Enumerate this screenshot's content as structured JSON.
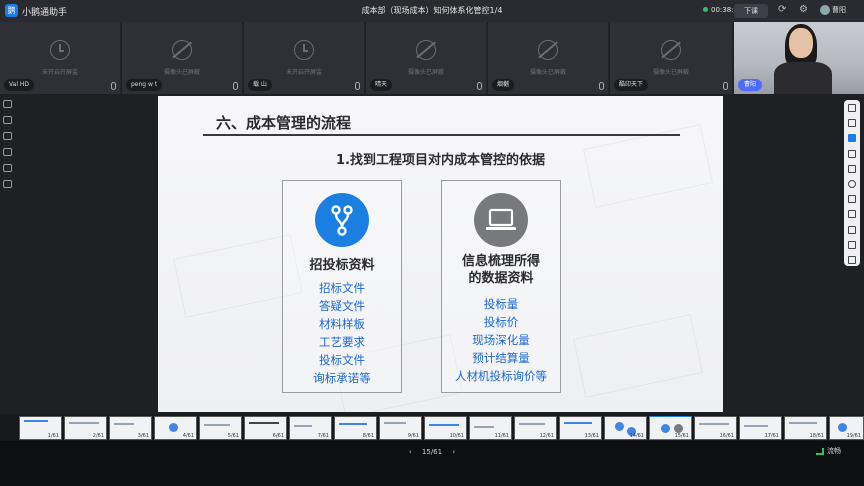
{
  "app": {
    "logo": "鹅",
    "title": "小鹅通助手"
  },
  "meeting": {
    "title": "成本部（现场成本）知何体系化管控1/4",
    "timer": "00:38:33",
    "leave_label": "下课"
  },
  "user": {
    "name": "曹阳"
  },
  "tiles": [
    {
      "name": "Val HD",
      "status": "未开启开屏监",
      "icon": "clock-icon"
    },
    {
      "name": "peng w t",
      "status": "摄像头已屏蔽",
      "icon": "camera-off-icon"
    },
    {
      "name": "载 山",
      "status": "未开启开屏监",
      "icon": "clock-icon"
    },
    {
      "name": "晴天",
      "status": "摄像头已屏蔽",
      "icon": "camera-off-icon"
    },
    {
      "name": "烟樾",
      "status": "摄像头已屏蔽",
      "icon": "camera-off-icon"
    },
    {
      "name": "酷印天下",
      "status": "摄像头已屏蔽",
      "icon": "camera-off-icon"
    }
  ],
  "host": {
    "name": "曹阳"
  },
  "slide": {
    "heading": "六、成本管理的流程",
    "subheading": "1.找到工程项目对内成本管控的依据",
    "left_card": {
      "title": "招投标资料",
      "items": [
        "招标文件",
        "答疑文件",
        "材料样板",
        "工艺要求",
        "投标文件",
        "询标承诺等"
      ]
    },
    "right_card": {
      "title_line1": "信息梳理所得",
      "title_line2": "的数据资料",
      "items": [
        "投标量",
        "投标价",
        "现场深化量",
        "预计结算量",
        "人材机投标询价等"
      ]
    }
  },
  "thumbnails": [
    "1/61",
    "2/61",
    "3/61",
    "4/61",
    "5/61",
    "6/61",
    "7/61",
    "8/61",
    "9/61",
    "10/61",
    "11/61",
    "12/61",
    "13/61",
    "14/61",
    "15/61",
    "16/61",
    "17/61",
    "18/61",
    "19/61"
  ],
  "pager": {
    "current": "15/61"
  },
  "network": {
    "label": "流畅"
  },
  "colors": {
    "accent": "#1e7be8",
    "list_text": "#1c67d4",
    "gray_icon": "#77797c"
  }
}
